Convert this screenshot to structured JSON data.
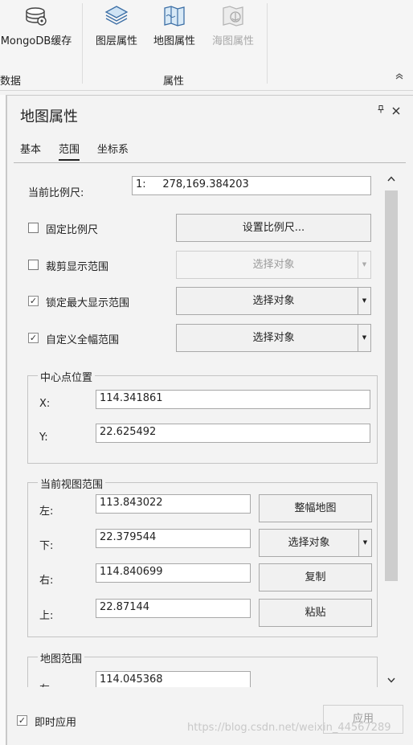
{
  "ribbon": {
    "buttons": [
      {
        "label": "MongoDB缓存",
        "icon": "mongodb-cache-icon",
        "disabled": false
      },
      {
        "label": "图层属性",
        "icon": "layers-icon",
        "disabled": false
      },
      {
        "label": "地图属性",
        "icon": "map-icon",
        "disabled": false
      },
      {
        "label": "海图属性",
        "icon": "nautical-chart-icon",
        "disabled": true
      }
    ],
    "groups": [
      {
        "label": "数据"
      },
      {
        "label": "属性"
      }
    ],
    "collapse_icon": "chevron-up-icon"
  },
  "panel": {
    "title": "地图属性",
    "tabs": [
      {
        "label": "基本",
        "active": false
      },
      {
        "label": "范围",
        "active": true
      },
      {
        "label": "坐标系",
        "active": false
      }
    ],
    "current_scale_label": "当前比例尺:",
    "current_scale_value": "1:     278,169.384203",
    "options": [
      {
        "label": "固定比例尺",
        "checked": false,
        "button": "设置比例尺...",
        "has_dropdown": false,
        "disabled": false
      },
      {
        "label": "裁剪显示范围",
        "checked": false,
        "button": "选择对象",
        "has_dropdown": true,
        "disabled": true
      },
      {
        "label": "锁定最大显示范围",
        "checked": true,
        "button": "选择对象",
        "has_dropdown": true,
        "disabled": false
      },
      {
        "label": "自定义全幅范围",
        "checked": true,
        "button": "选择对象",
        "has_dropdown": true,
        "disabled": false
      }
    ],
    "center": {
      "legend": "中心点位置",
      "x_label": "X:",
      "x_value": "114.341861",
      "y_label": "Y:",
      "y_value": "22.625492"
    },
    "view_extent": {
      "legend": "当前视图范围",
      "left_label": "左:",
      "left_value": "113.843022",
      "bottom_label": "下:",
      "bottom_value": "22.379544",
      "right_label": "右:",
      "right_value": "114.840699",
      "top_label": "上:",
      "top_value": "22.87144",
      "full_extent_button": "整幅地图",
      "select_object_button": "选择对象",
      "copy_button": "复制",
      "paste_button": "粘贴"
    },
    "map_extent": {
      "legend": "地图范围",
      "left_label": "左:",
      "left_value": "114.045368"
    },
    "instant_apply_label": "即时应用",
    "instant_apply_checked": true,
    "apply_button": "应用"
  },
  "watermark": "https://blog.csdn.net/weixin_44567289"
}
